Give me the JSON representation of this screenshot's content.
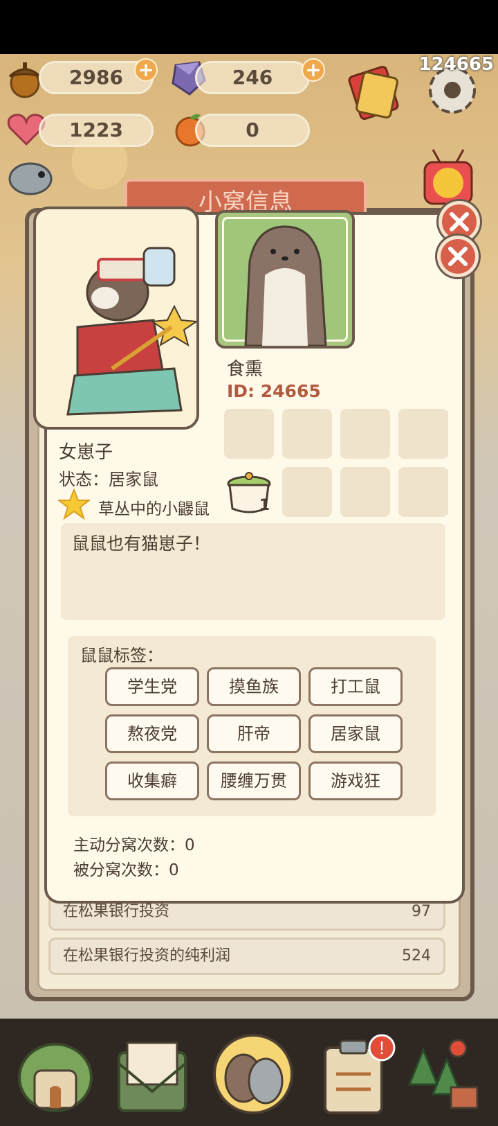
{
  "topbar": {
    "user_id": "124665",
    "acorns": "2986",
    "gems": "246",
    "hearts": "1223",
    "oranges": "0"
  },
  "banner_title": "小窝信息",
  "card": {
    "nickname": "食熏",
    "id_text": "ID: 24665",
    "title": "女崽子",
    "state": "状态：居家鼠",
    "badge": "草丛中的小鼹鼠",
    "item_count": "1",
    "motto": "鼠鼠也有猫崽子！",
    "tags_label": "鼠鼠标签：",
    "tags": [
      "学生党",
      "摸鱼族",
      "打工鼠",
      "熬夜党",
      "肝帝",
      "居家鼠",
      "收集癖",
      "腰缠万贯",
      "游戏狂"
    ],
    "stat_active": "主动分窝次数：0",
    "stat_passive": "被分窝次数：0"
  },
  "background_stats": [
    {
      "label": "在松果银行投资",
      "value": "97"
    },
    {
      "label": "在松果银行投资的纯利润",
      "value": "524"
    }
  ],
  "colors": {
    "accent": "#d8604a",
    "panel_border": "#6b5a4b",
    "card_bg": "#fff9e9",
    "id_text": "#b15a3f"
  }
}
